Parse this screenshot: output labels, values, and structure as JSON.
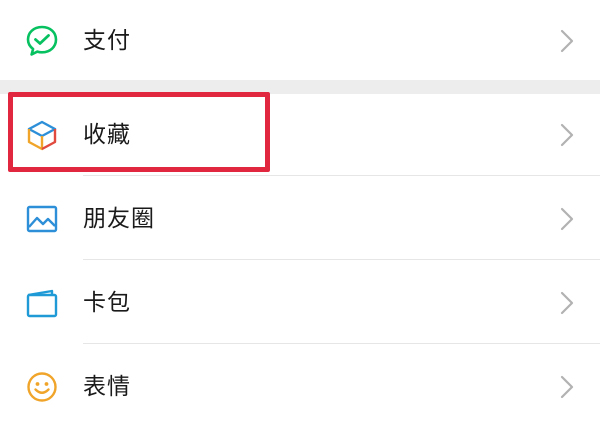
{
  "menu": {
    "items": [
      {
        "label": "支付",
        "icon": "wechat-pay-icon"
      },
      {
        "label": "收藏",
        "icon": "favorites-cube-icon"
      },
      {
        "label": "朋友圈",
        "icon": "moments-picture-icon"
      },
      {
        "label": "卡包",
        "icon": "card-wallet-icon"
      },
      {
        "label": "表情",
        "icon": "sticker-smiley-icon"
      }
    ]
  },
  "colors": {
    "pay_green": "#07c160",
    "highlight_red": "#e0273f",
    "moments_blue": "#2d8fd8",
    "card_teal": "#1f9ad6",
    "sticker_yellow": "#f0a52a",
    "chevron_gray": "#b2b2b2"
  }
}
